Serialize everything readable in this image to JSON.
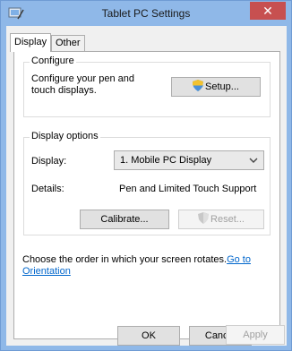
{
  "window": {
    "title": "Tablet PC Settings",
    "close_label": "✕"
  },
  "tabs": [
    {
      "label": "Display",
      "active": true
    },
    {
      "label": "Other",
      "active": false
    }
  ],
  "configure": {
    "group_label": "Configure",
    "description": "Configure your pen and touch displays.",
    "setup_label": "Setup..."
  },
  "display_options": {
    "group_label": "Display options",
    "display_label": "Display:",
    "display_value": "1. Mobile PC Display",
    "details_label": "Details:",
    "details_value": "Pen and Limited Touch Support",
    "calibrate_label": "Calibrate...",
    "reset_label": "Reset..."
  },
  "orientation": {
    "text": "Choose the order in which your screen rotates.",
    "link_label": "Go to Orientation"
  },
  "footer": {
    "ok_label": "OK",
    "cancel_label": "Cancel",
    "apply_label": "Apply"
  },
  "colors": {
    "title_bar": "#8fb8e8",
    "close_button": "#c75050",
    "link": "#0066cc"
  }
}
